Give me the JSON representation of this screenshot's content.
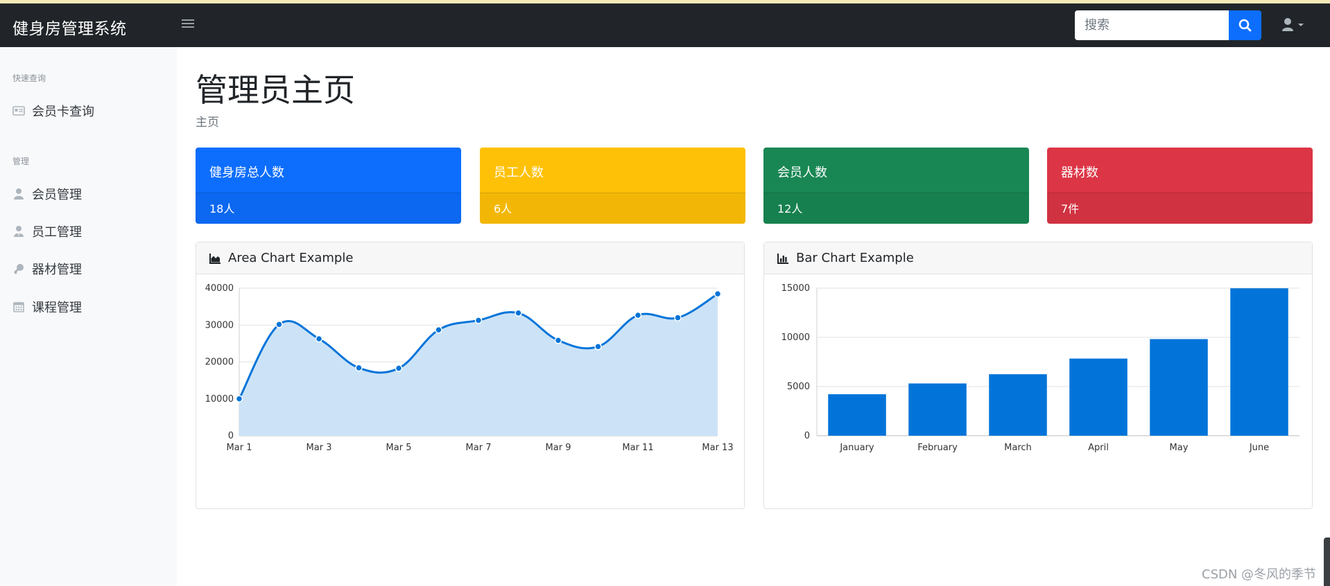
{
  "app": {
    "brand": "健身房管理系统"
  },
  "header": {
    "search": {
      "placeholder": "搜索",
      "value": ""
    },
    "icons": {
      "menu": "hamburger-icon",
      "search": "search-icon",
      "user": "user-icon",
      "caret": "caret-down-icon"
    }
  },
  "sidebar": {
    "sections": [
      {
        "heading": "快速查询",
        "items": [
          {
            "label": "会员卡查询",
            "icon": "id-card-icon"
          }
        ]
      },
      {
        "heading": "管理",
        "items": [
          {
            "label": "会员管理",
            "icon": "user-icon"
          },
          {
            "label": "员工管理",
            "icon": "user-tie-icon"
          },
          {
            "label": "器材管理",
            "icon": "dumbbell-icon"
          },
          {
            "label": "课程管理",
            "icon": "calendar-icon"
          }
        ]
      }
    ]
  },
  "main": {
    "title": "管理员主页",
    "breadcrumb": "主页",
    "cards": [
      {
        "title": "健身房总人数",
        "value": "18人",
        "color": "#0d6efd"
      },
      {
        "title": "员工人数",
        "value": "6人",
        "color": "#ffc107"
      },
      {
        "title": "会员人数",
        "value": "12人",
        "color": "#198754"
      },
      {
        "title": "器材数",
        "value": "7件",
        "color": "#dc3545"
      }
    ]
  },
  "chart_data": [
    {
      "type": "area",
      "title": "Area Chart Example",
      "icon": "area-chart-icon",
      "x": [
        "Mar 1",
        "Mar 2",
        "Mar 3",
        "Mar 4",
        "Mar 5",
        "Mar 6",
        "Mar 7",
        "Mar 8",
        "Mar 9",
        "Mar 10",
        "Mar 11",
        "Mar 12",
        "Mar 13"
      ],
      "x_tick_labels": [
        "Mar 1",
        "Mar 3",
        "Mar 5",
        "Mar 7",
        "Mar 9",
        "Mar 11",
        "Mar 13"
      ],
      "values": [
        10000,
        30162,
        26263,
        18394,
        18287,
        28682,
        31274,
        33259,
        25849,
        24159,
        32651,
        31984,
        38451
      ],
      "ylim": [
        0,
        40000
      ],
      "y_ticks": [
        0,
        10000,
        20000,
        30000,
        40000
      ],
      "grid": true,
      "line_color": "#0274d9",
      "fill_color": "#cce3f7"
    },
    {
      "type": "bar",
      "title": "Bar Chart Example",
      "icon": "bar-chart-icon",
      "categories": [
        "January",
        "February",
        "March",
        "April",
        "May",
        "June"
      ],
      "values": [
        4215,
        5312,
        6251,
        7841,
        9821,
        14984
      ],
      "ylim": [
        0,
        15000
      ],
      "y_ticks": [
        0,
        5000,
        10000,
        15000
      ],
      "grid": true,
      "bar_color": "#0274d9"
    }
  ],
  "watermark": "CSDN @冬风的季节"
}
